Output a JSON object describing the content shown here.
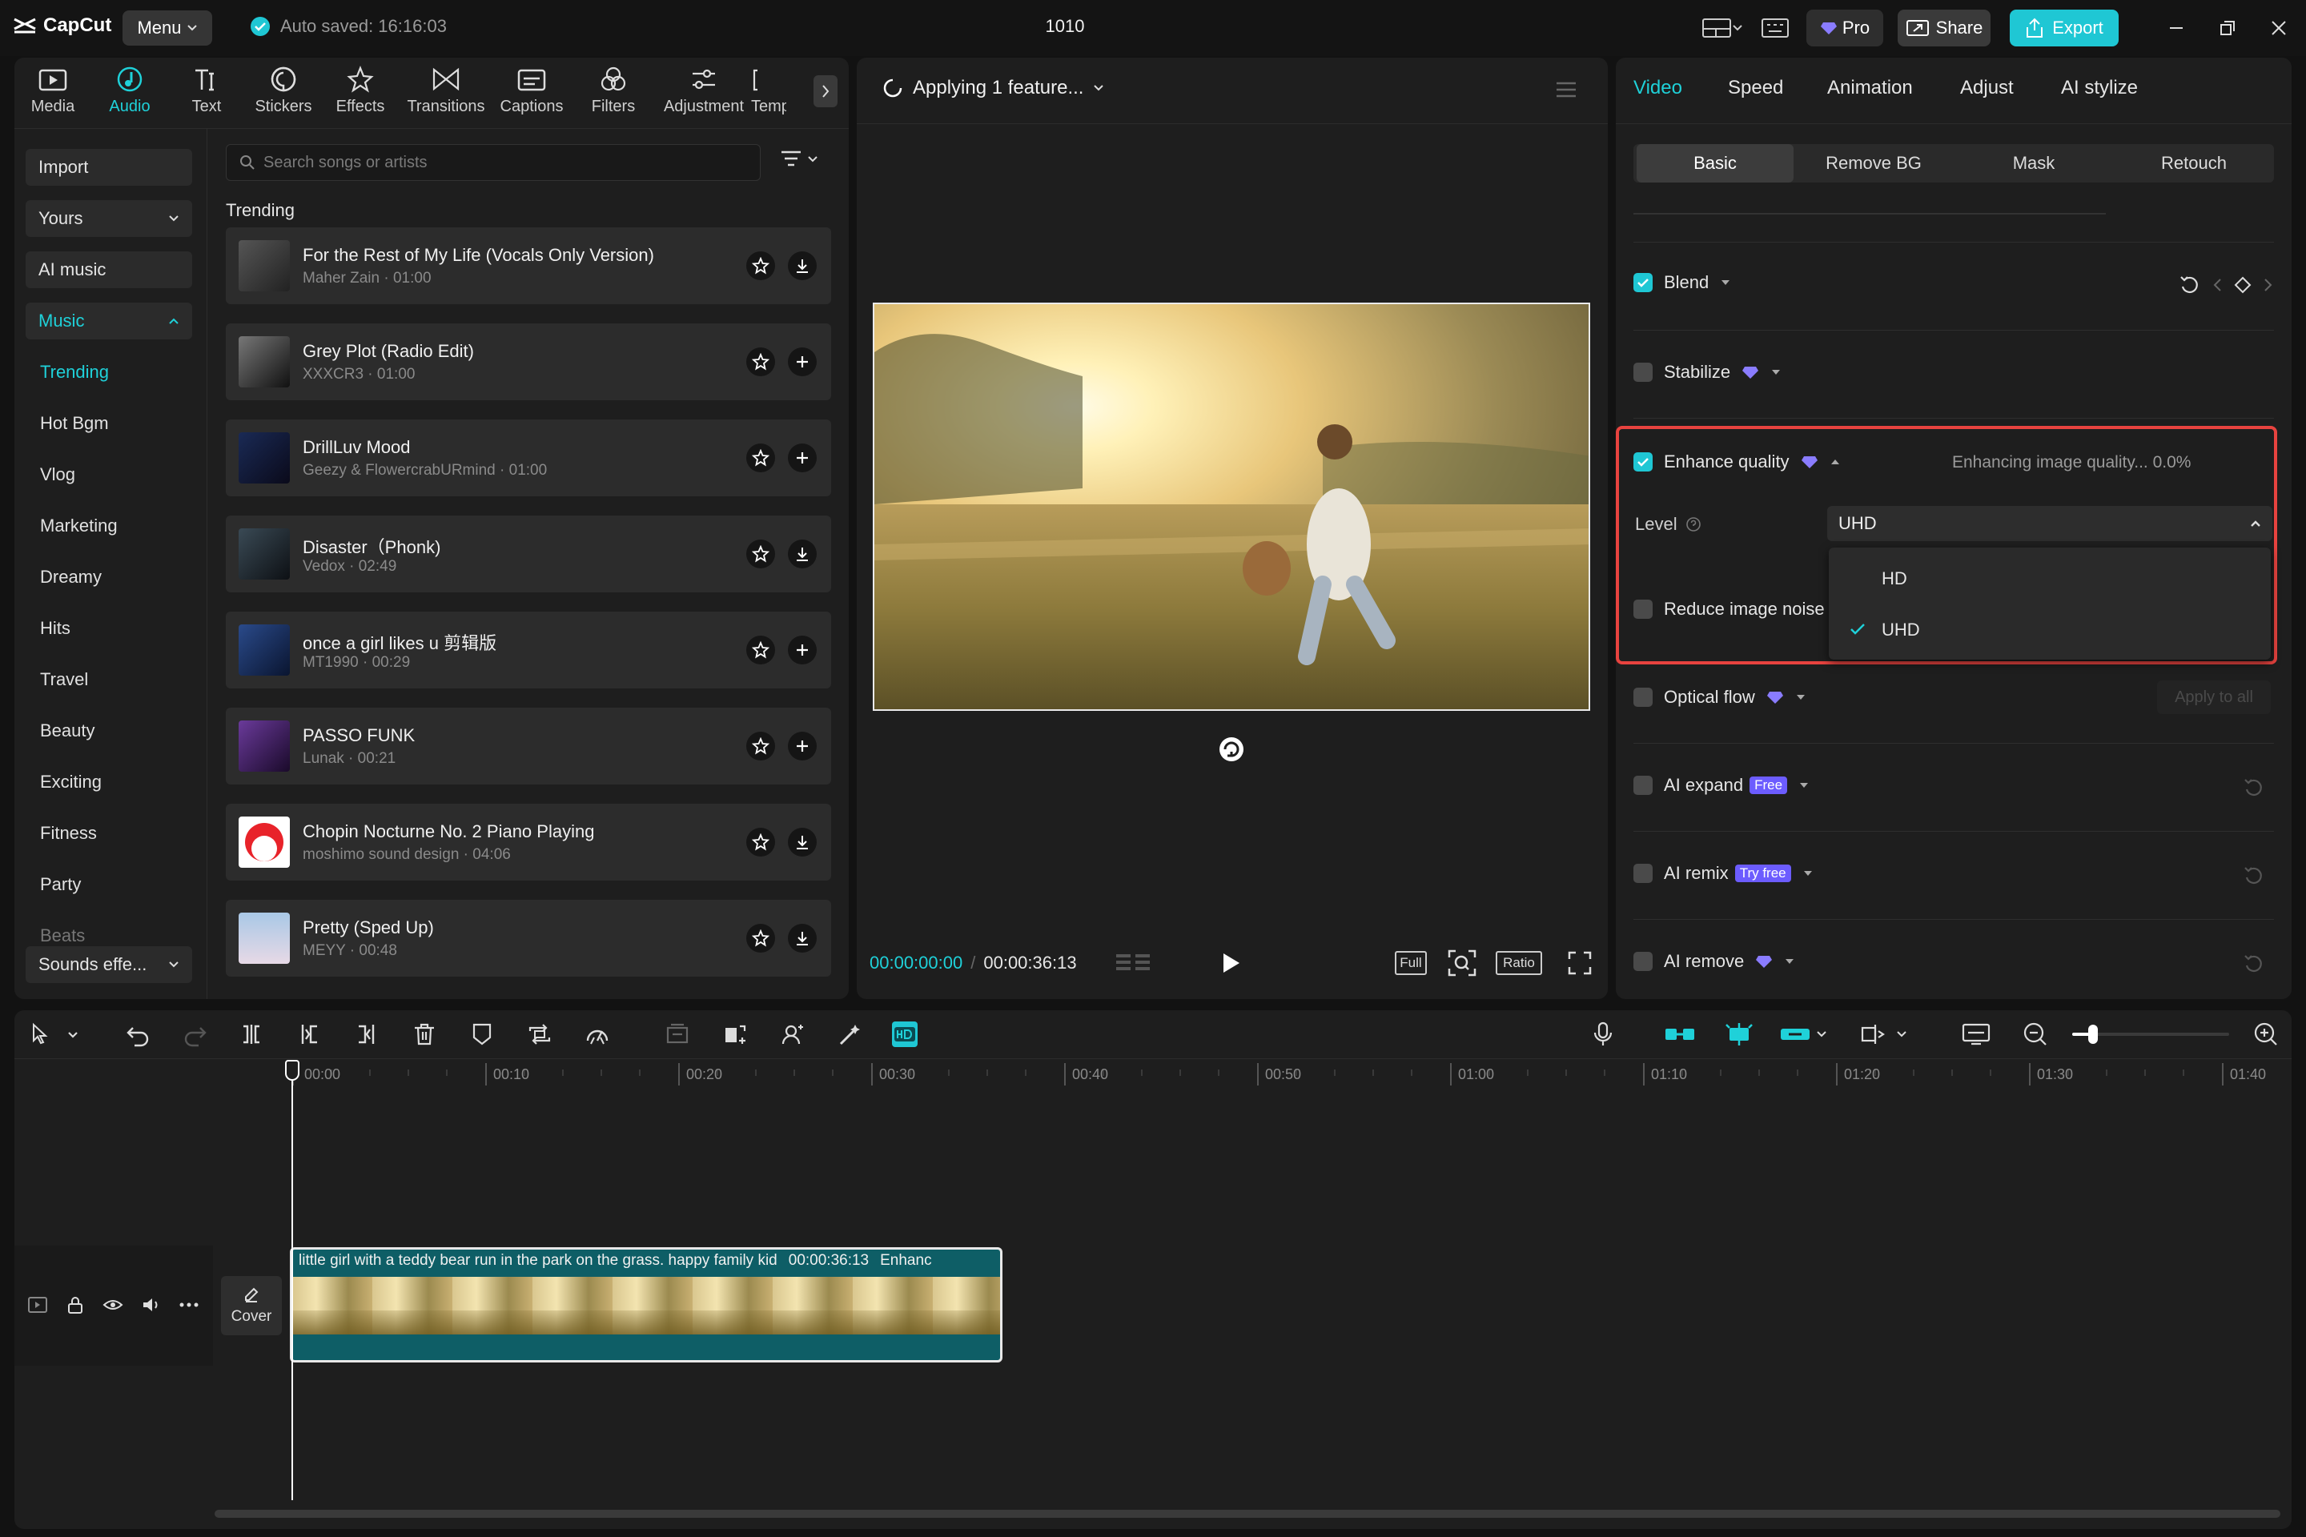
{
  "app": {
    "name": "CapCut",
    "menu_label": "Menu",
    "autosave": "Auto saved: 16:16:03",
    "project_title": "1010"
  },
  "topbar": {
    "pro_label": "Pro",
    "share_label": "Share",
    "export_label": "Export"
  },
  "colors": {
    "accent": "#1fd1d9",
    "export_bg": "#1fc7d4",
    "highlight_border": "#e8433f",
    "clip_bg": "#0e5e66",
    "pro_purple": "#8a7cff"
  },
  "tool_tabs": [
    {
      "label": "Media",
      "icon": "media-icon"
    },
    {
      "label": "Audio",
      "icon": "audio-icon"
    },
    {
      "label": "Text",
      "icon": "text-icon"
    },
    {
      "label": "Stickers",
      "icon": "stickers-icon"
    },
    {
      "label": "Effects",
      "icon": "effects-icon"
    },
    {
      "label": "Transitions",
      "icon": "transitions-icon"
    },
    {
      "label": "Captions",
      "icon": "captions-icon"
    },
    {
      "label": "Filters",
      "icon": "filters-icon"
    },
    {
      "label": "Adjustment",
      "icon": "adjustment-icon"
    },
    {
      "label": "Temp",
      "icon": "templates-icon"
    }
  ],
  "left_nav": {
    "import": "Import",
    "yours": "Yours",
    "ai_music": "AI music",
    "music": "Music",
    "items": [
      "Trending",
      "Hot Bgm",
      "Vlog",
      "Marketing",
      "Dreamy",
      "Hits",
      "Travel",
      "Beauty",
      "Exciting",
      "Fitness",
      "Party",
      "Beats"
    ],
    "sounds": "Sounds effe..."
  },
  "music": {
    "search_placeholder": "Search songs or artists",
    "section_title": "Trending",
    "songs": [
      {
        "title": "For the Rest of My Life (Vocals Only Version)",
        "meta": "Maher Zain · 01:00",
        "action": "download-icon"
      },
      {
        "title": "Grey Plot (Radio Edit)",
        "meta": "XXXCR3 · 01:00",
        "action": "add-icon"
      },
      {
        "title": "DrillLuv Mood",
        "meta": "Geezy & FlowercrabURmind · 01:00",
        "action": "add-icon"
      },
      {
        "title": "Disaster（Phonk)",
        "meta": "Vedox · 02:49",
        "action": "download-icon"
      },
      {
        "title": "once a girl likes u 剪辑版",
        "meta": "MT1990 · 00:29",
        "action": "add-icon"
      },
      {
        "title": "PASSO FUNK",
        "meta": "Lunak · 00:21",
        "action": "add-icon"
      },
      {
        "title": "Chopin Nocturne No. 2 Piano Playing",
        "meta": "moshimo sound design · 04:06",
        "action": "download-icon"
      },
      {
        "title": "Pretty (Sped Up)",
        "meta": "MEYY · 00:48",
        "action": "download-icon"
      }
    ]
  },
  "player": {
    "status": "Applying 1 feature...",
    "current_time": "00:00:00:00",
    "total_time": "00:00:36:13",
    "full_label": "Full",
    "ratio_label": "Ratio"
  },
  "right_panel": {
    "tabs": [
      "Video",
      "Speed",
      "Animation",
      "Adjust",
      "AI stylize"
    ],
    "subtabs": [
      "Basic",
      "Remove BG",
      "Mask",
      "Retouch"
    ],
    "blend": "Blend",
    "stabilize": "Stabilize",
    "enhance_quality": "Enhance quality",
    "enhance_status": "Enhancing image quality... 0.0%",
    "level_label": "Level",
    "level_value": "UHD",
    "level_options": [
      "HD",
      "UHD"
    ],
    "reduce_noise": "Reduce image noise",
    "optical_flow": "Optical flow",
    "apply_all": "Apply to all",
    "ai_expand": "AI expand",
    "ai_expand_badge": "Free",
    "ai_remix": "AI remix",
    "ai_remix_badge": "Try free",
    "ai_remove": "AI remove"
  },
  "timeline": {
    "ruler": [
      "00:00",
      "00:10",
      "00:20",
      "00:30",
      "00:40",
      "00:50",
      "01:00",
      "01:10",
      "01:20",
      "01:30",
      "01:40"
    ],
    "clip_title": "little girl with a teddy bear run in the park on the grass. happy family kid",
    "clip_duration": "00:00:36:13",
    "clip_tag": "Enhanc",
    "cover_label": "Cover"
  }
}
